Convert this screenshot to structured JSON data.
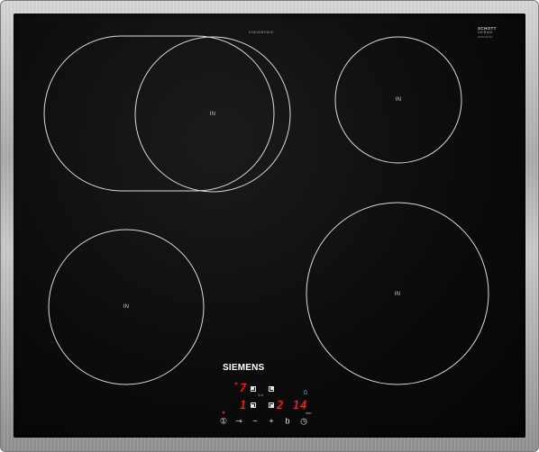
{
  "hob": {
    "model_code": "EH645BFB1E",
    "schott_brand": "SCHOTT",
    "schott_product": "CERAN",
    "schott_code": "EK6N4F7E",
    "brand": "SIEMENS"
  },
  "zones": [
    {
      "id": "front-left-extended",
      "label": "IN"
    },
    {
      "id": "rear-right",
      "label": "IN"
    },
    {
      "id": "front-left",
      "label": "IN"
    },
    {
      "id": "front-right",
      "label": "IN"
    }
  ],
  "controls": {
    "display_rear_left": "7",
    "display_front_left": "1",
    "display_front_right": "2",
    "timer_display": "14",
    "power_symbol": "①",
    "key_symbol": "⊸",
    "minus_symbol": "−",
    "plus_symbol": "+",
    "boost_symbol": "b",
    "timer_symbol": "◷",
    "bell_symbol": "⌂",
    "tiny_label_1": "1-4",
    "tiny_label_2": "min"
  },
  "colors": {
    "glass": "#0b0b0b",
    "zone_outline": "#dcdcdc",
    "display_red": "#ff2b2b",
    "frame_steel": "#b5b5b5"
  }
}
